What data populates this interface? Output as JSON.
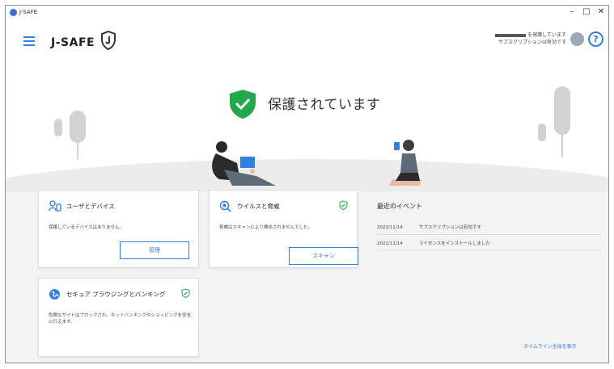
{
  "window": {
    "title": "J-SAFE",
    "minimize": "–",
    "maximize": "□",
    "close": "✕"
  },
  "header": {
    "brand": "J-SAFE",
    "account_line1": "を保護しています",
    "account_line2": "サブスクリプションは有効です",
    "help": "?"
  },
  "status": {
    "text": "保護されています",
    "color": "#21a84a"
  },
  "cards": {
    "users": {
      "title": "ユーザとデバイス",
      "desc": "保護しているデバイスはありません。",
      "button": "管理"
    },
    "virus": {
      "title": "ウイルスと脅威",
      "desc": "脅威はスキャンにより検出されませんでした。",
      "button": "スキャン"
    },
    "secure": {
      "title": "セキュア ブラウジングとバンキング",
      "desc": "危険なサイトはブロックされ、ネットバンキングやショッピングを安全に行えます。"
    }
  },
  "events": {
    "title": "最近のイベント",
    "items": [
      {
        "date": "2022/11/14",
        "text": "サブスクリプションは有効です"
      },
      {
        "date": "2022/11/14",
        "text": "ライセンスをインストールしました"
      }
    ],
    "link": "タイムライン全体を表示"
  },
  "colors": {
    "accent": "#2f7fe6",
    "ok": "#21a84a"
  }
}
